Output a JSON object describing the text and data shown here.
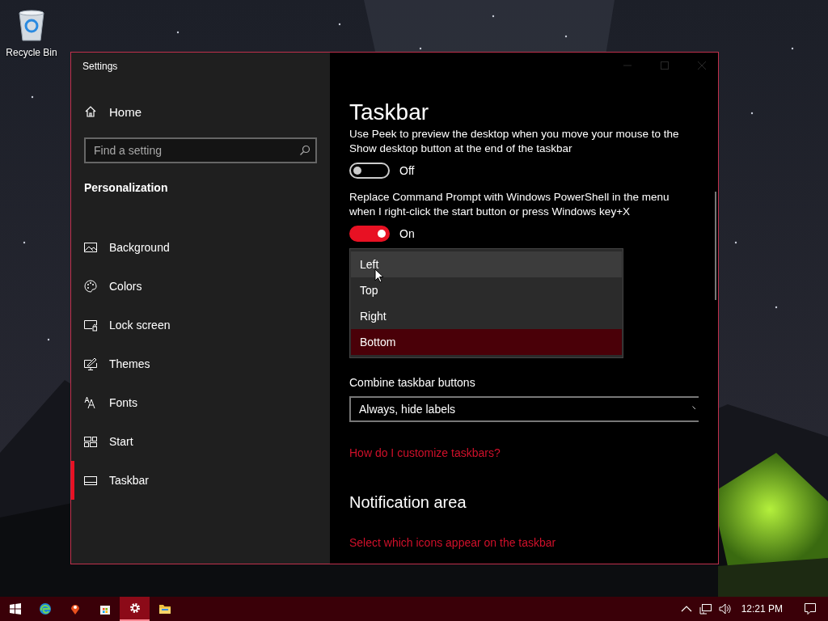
{
  "desktop": {
    "icons": [
      {
        "kind": "recycle-bin",
        "label": "Recycle Bin"
      }
    ]
  },
  "window": {
    "title": "Settings"
  },
  "sidebar": {
    "home": "Home",
    "search": {
      "placeholder": "Find a setting"
    },
    "section": "Personalization",
    "items": [
      {
        "kind": "picture",
        "label": "Background",
        "selected": false
      },
      {
        "kind": "palette",
        "label": "Colors",
        "selected": false
      },
      {
        "kind": "lock",
        "label": "Lock screen",
        "selected": false
      },
      {
        "kind": "brush",
        "label": "Themes",
        "selected": false
      },
      {
        "kind": "fonts",
        "label": "Fonts",
        "selected": false
      },
      {
        "kind": "tiles",
        "label": "Start",
        "selected": false
      },
      {
        "kind": "taskbar",
        "label": "Taskbar",
        "selected": true
      }
    ]
  },
  "content": {
    "title": "Taskbar",
    "settings": [
      {
        "kind": "toggle",
        "description": "Use Peek to preview the desktop when you move your mouse to the Show desktop button at the end of the taskbar",
        "on": false,
        "state_label": "Off"
      },
      {
        "kind": "toggle",
        "description": "Replace Command Prompt with Windows PowerShell in the menu when I right-click the start button or press Windows key+X",
        "on": true,
        "state_label": "On"
      },
      {
        "kind": "menu",
        "options": [
          {
            "label": "Left",
            "selected": false,
            "hovered": true
          },
          {
            "label": "Top",
            "selected": false,
            "hovered": false
          },
          {
            "label": "Right",
            "selected": false,
            "hovered": false
          },
          {
            "label": "Bottom",
            "selected": true,
            "hovered": false
          }
        ]
      },
      {
        "kind": "dropdown",
        "label": "Combine taskbar buttons",
        "value": "Always, hide labels"
      },
      {
        "kind": "link",
        "text": "How do I customize taskbars?"
      },
      {
        "kind": "heading",
        "text": "Notification area"
      },
      {
        "kind": "link",
        "text": "Select which icons appear on the taskbar"
      }
    ]
  },
  "taskbar": {
    "apps": [
      {
        "kind": "start",
        "selected": false
      },
      {
        "kind": "browser",
        "selected": false
      },
      {
        "kind": "pin",
        "selected": false
      },
      {
        "kind": "store",
        "selected": false
      },
      {
        "kind": "settings",
        "selected": true
      },
      {
        "kind": "folder",
        "selected": false
      }
    ],
    "tray": [
      {
        "kind": "chevron"
      },
      {
        "kind": "network"
      },
      {
        "kind": "volume"
      }
    ],
    "clock": "12:21 PM"
  }
}
